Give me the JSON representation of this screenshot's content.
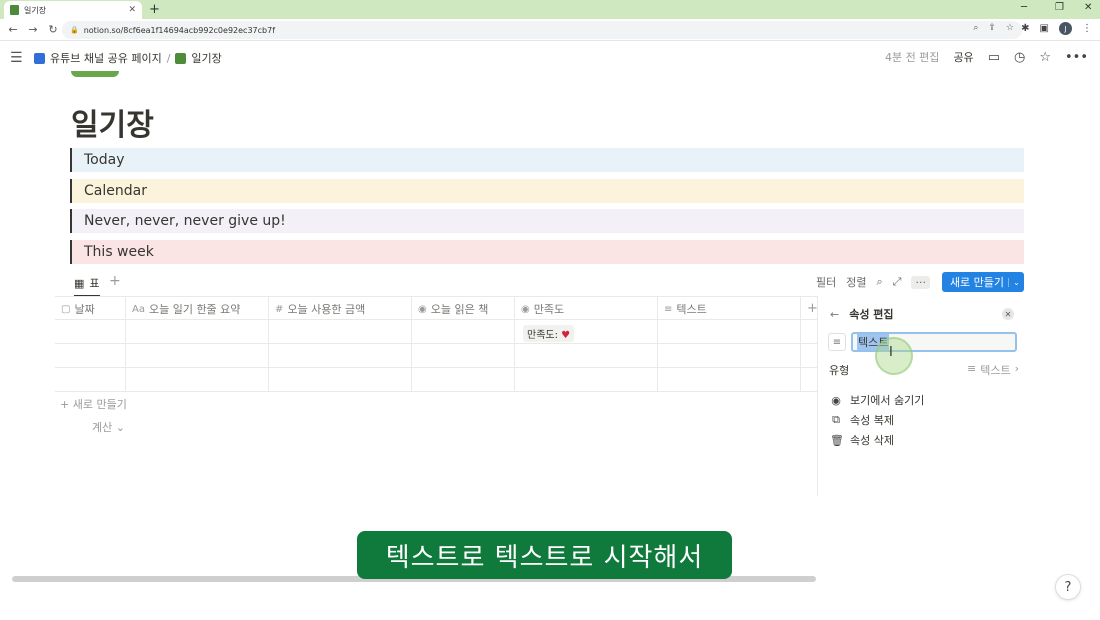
{
  "browser": {
    "tab_title": "일기장",
    "new_tab": "+",
    "url": "notion.so/8cf6ea1f14694acb992c0e92ec37cb7f",
    "profile_initial": "J"
  },
  "topbar": {
    "breadcrumb_parent": "유튜브 채널 공유 페이지",
    "breadcrumb_sep": "/",
    "breadcrumb_current": "일기장",
    "edited": "4분 전 편집",
    "share": "공유"
  },
  "page": {
    "title": "일기장",
    "callouts": [
      "Today",
      "Calendar",
      "Never, never, never give up!",
      "This week"
    ]
  },
  "database": {
    "view_label": "표",
    "filter": "필터",
    "sort": "정렬",
    "new_button": "새로 만들기",
    "columns": [
      {
        "icon": "▢",
        "label": "날짜"
      },
      {
        "icon": "Aa",
        "label": "오늘 일기 한줄 요약"
      },
      {
        "icon": "#",
        "label": "오늘 사용한 금액"
      },
      {
        "icon": "◉",
        "label": "오늘 읽은 책"
      },
      {
        "icon": "◉",
        "label": "만족도"
      },
      {
        "icon": "≡",
        "label": "텍스트"
      }
    ],
    "chip_label": "만족도:",
    "chip_heart": "♥",
    "new_row": "+ 새로 만들기",
    "calculate": "계산 ⌄"
  },
  "panel": {
    "title": "속성 편집",
    "name_value": "텍스트",
    "type_label": "유형",
    "type_value": "텍스트",
    "hide": "보기에서 숨기기",
    "duplicate": "속성 복제",
    "delete": "속성 삭제"
  },
  "caption": "텍스트로 텍스트로 시작해서",
  "help": "?"
}
